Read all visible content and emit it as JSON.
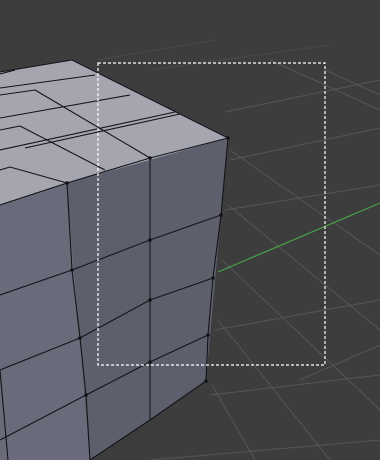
{
  "viewport": {
    "background_color": "#3d3d3d",
    "grid_color": "#565656",
    "x_axis_color": "#49a34a",
    "mesh": {
      "object": "cube",
      "subdivisions_per_edge": 4,
      "top_face_color": "#a5a5b0",
      "front_face_color": "#6a6b7a",
      "right_face_color": "#5e5f6d",
      "edge_color": "#141418"
    },
    "box_select": {
      "active": true,
      "style": "dashed",
      "color": "#ffffff"
    }
  }
}
